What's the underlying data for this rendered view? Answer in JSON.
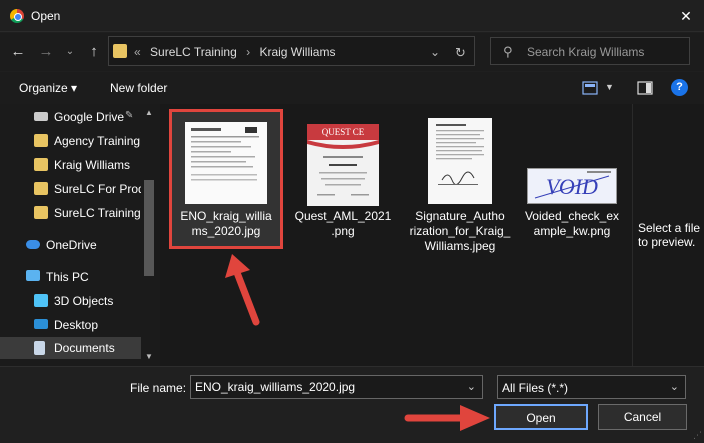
{
  "window": {
    "title": "Open",
    "close_glyph": "✕"
  },
  "nav": {
    "back_glyph": "←",
    "forward_glyph": "→",
    "recent_glyph": "⌄",
    "up_glyph": "↑",
    "breadcrumbs": [
      "«",
      "SureLC Training",
      "›",
      "Kraig Williams"
    ],
    "dropdown_glyph": "⌄",
    "refresh_glyph": "↻",
    "search_placeholder": "Search Kraig Williams"
  },
  "commands": {
    "organize": "Organize ▾",
    "new_folder": "New folder"
  },
  "sidebar": {
    "items": [
      {
        "label": "Google Drive",
        "pin": "📌",
        "icon": "drive-icon"
      },
      {
        "label": "Agency Training",
        "icon": "folder-icon"
      },
      {
        "label": "Kraig Williams",
        "icon": "folder-icon"
      },
      {
        "label": "SureLC For Prod",
        "icon": "folder-icon"
      },
      {
        "label": "SureLC Training",
        "icon": "folder-icon"
      },
      {
        "label": "OneDrive",
        "icon": "cloud-icon"
      },
      {
        "label": "This PC",
        "icon": "computer-icon"
      },
      {
        "label": "3D Objects",
        "icon": "cube-icon"
      },
      {
        "label": "Desktop",
        "icon": "desktop-icon"
      },
      {
        "label": "Documents",
        "icon": "documents-icon"
      }
    ]
  },
  "files": [
    {
      "name": "ENO_kraig_williams_2020.jpg",
      "display": "ENO_kraig_willia\nms_2020.jpg"
    },
    {
      "name": "Quest_AML_2021.png",
      "display": "Quest_AML_2021\n.png",
      "thumb_text": "QUEST CE"
    },
    {
      "name": "Signature_Authorization_for_Kraig_Williams.jpeg",
      "display": "Signature_Autho\nrization_for_Kraig_\nWilliams.jpeg"
    },
    {
      "name": "Voided_check_example_kw.png",
      "display": "Voided_check_ex\nample_kw.png",
      "thumb_text": "VOID"
    }
  ],
  "preview": {
    "message": "Select a file to preview."
  },
  "footer": {
    "file_name_label": "File name:",
    "file_name_value": "ENO_kraig_williams_2020.jpg",
    "file_type": "All Files (*.*)",
    "open_label": "Open",
    "cancel_label": "Cancel"
  },
  "colors": {
    "accent_red": "#e0453d",
    "help_blue": "#1a73e8",
    "folder": "#e8c462"
  }
}
